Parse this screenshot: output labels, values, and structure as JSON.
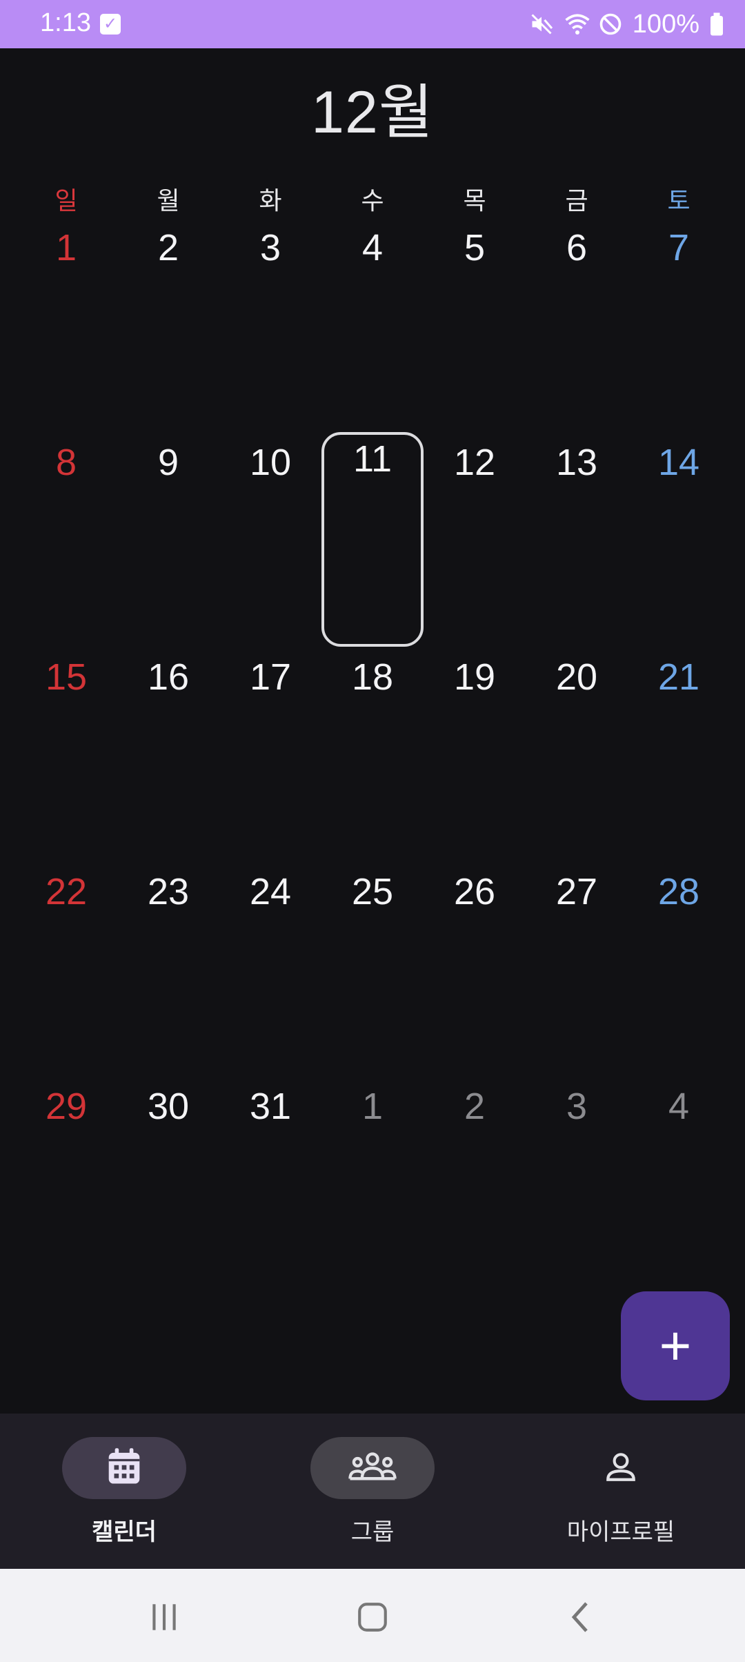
{
  "status": {
    "time": "1:13",
    "battery": "100%",
    "icons": [
      "check-notification-icon",
      "mute-icon",
      "wifi-icon",
      "do-not-disturb-icon",
      "battery-icon"
    ]
  },
  "calendar": {
    "month_title": "12월",
    "weekdays": [
      "일",
      "월",
      "화",
      "수",
      "목",
      "금",
      "토"
    ],
    "weeks": [
      [
        "1",
        "2",
        "3",
        "4",
        "5",
        "6",
        "7"
      ],
      [
        "8",
        "9",
        "10",
        "11",
        "12",
        "13",
        "14"
      ],
      [
        "15",
        "16",
        "17",
        "18",
        "19",
        "20",
        "21"
      ],
      [
        "22",
        "23",
        "24",
        "25",
        "26",
        "27",
        "28"
      ],
      [
        "29",
        "30",
        "31",
        "1",
        "2",
        "3",
        "4"
      ]
    ],
    "today": "11",
    "colors": {
      "sunday": "#d33437",
      "saturday": "#6ea6e6",
      "today_border": "#dcdcdf",
      "outside_month": "#8c8c90"
    }
  },
  "fab": {
    "label": "+",
    "color": "#4f3694"
  },
  "bottom_nav": {
    "items": [
      {
        "label": "캘린더",
        "icon": "calendar-icon",
        "active": true
      },
      {
        "label": "그룹",
        "icon": "group-icon",
        "active": false
      },
      {
        "label": "마이프로필",
        "icon": "profile-icon",
        "active": false
      }
    ]
  },
  "system_nav": {
    "icons": [
      "recent-apps-icon",
      "home-icon",
      "back-icon"
    ]
  }
}
